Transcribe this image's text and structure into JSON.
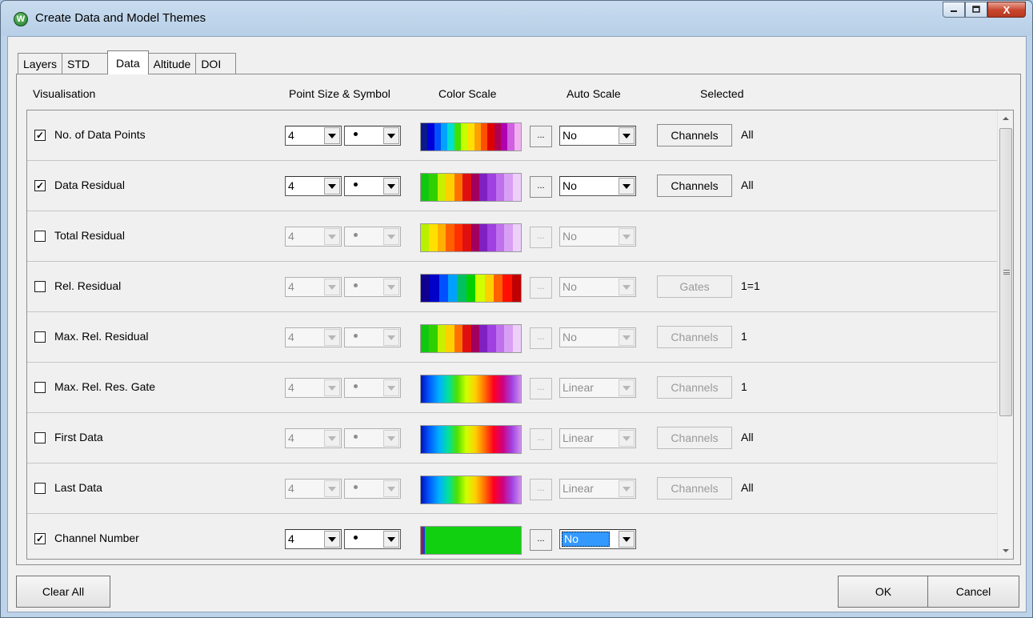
{
  "window": {
    "title": "Create Data and Model Themes",
    "icon_letter": "W"
  },
  "caption": {
    "minimize": "minimize-icon",
    "maximize": "maximize-icon",
    "close_label": "X"
  },
  "tabs": [
    {
      "label": "Layers",
      "active": false
    },
    {
      "label": "STD",
      "active": false
    },
    {
      "label": "Data",
      "active": true
    },
    {
      "label": "Altitude",
      "active": false
    },
    {
      "label": "DOI",
      "active": false
    }
  ],
  "columns": {
    "visualisation": "Visualisation",
    "point": "Point Size & Symbol",
    "color": "Color Scale",
    "auto": "Auto Scale",
    "selected": "Selected"
  },
  "rows": [
    {
      "label": "No. of Data Points",
      "checked": true,
      "check_mark": "✓",
      "size": "4",
      "symbol": "•",
      "auto": "No",
      "sel_button": "Channels",
      "sel_value": "All",
      "scale": "A"
    },
    {
      "label": "Data Residual",
      "checked": true,
      "check_mark": "✓",
      "size": "4",
      "symbol": "•",
      "auto": "No",
      "sel_button": "Channels",
      "sel_value": "All",
      "scale": "B"
    },
    {
      "label": "Total Residual",
      "checked": false,
      "check_mark": "",
      "size": "4",
      "symbol": "•",
      "auto": "No",
      "sel_button": "",
      "sel_value": "",
      "scale": "C"
    },
    {
      "label": "Rel. Residual",
      "checked": false,
      "check_mark": "",
      "size": "4",
      "symbol": "•",
      "auto": "No",
      "sel_button": "Gates",
      "sel_value": "1=1",
      "scale": "D"
    },
    {
      "label": "Max. Rel. Residual",
      "checked": false,
      "check_mark": "",
      "size": "4",
      "symbol": "•",
      "auto": "No",
      "sel_button": "Channels",
      "sel_value": "1",
      "scale": "B"
    },
    {
      "label": "Max. Rel. Res. Gate",
      "checked": false,
      "check_mark": "",
      "size": "4",
      "symbol": "•",
      "auto": "Linear",
      "sel_button": "Channels",
      "sel_value": "1",
      "scale": "G"
    },
    {
      "label": "First Data",
      "checked": false,
      "check_mark": "",
      "size": "4",
      "symbol": "•",
      "auto": "Linear",
      "sel_button": "Channels",
      "sel_value": "All",
      "scale": "G"
    },
    {
      "label": "Last Data",
      "checked": false,
      "check_mark": "",
      "size": "4",
      "symbol": "•",
      "auto": "Linear",
      "sel_button": "Channels",
      "sel_value": "All",
      "scale": "G"
    },
    {
      "label": "Channel Number",
      "checked": true,
      "check_mark": "✓",
      "size": "4",
      "symbol": "•",
      "auto": "No",
      "sel_button": "",
      "sel_value": "",
      "scale": "H"
    }
  ],
  "color_scales": {
    "A": [
      "#0a1a8c",
      "#0000d8",
      "#0050ff",
      "#00a4ff",
      "#00e0d0",
      "#40e000",
      "#c8ff00",
      "#ffe000",
      "#ffa000",
      "#ff5000",
      "#e00000",
      "#b00050",
      "#b000b0",
      "#d060e0",
      "#f0b0f0"
    ],
    "B": [
      "#10c810",
      "#30d000",
      "#c8f000",
      "#ffd000",
      "#ff7000",
      "#e01010",
      "#a00060",
      "#8020c0",
      "#a040e0",
      "#c070ec",
      "#d8a0f4",
      "#ecd0fa"
    ],
    "C": [
      "#b8f000",
      "#ffe000",
      "#ffb000",
      "#ff6000",
      "#ff3000",
      "#e01010",
      "#a00060",
      "#8020c0",
      "#a040e0",
      "#c070ec",
      "#d8a0f4",
      "#ecd0fa"
    ],
    "D": [
      "#100090",
      "#0000c8",
      "#0050ff",
      "#00a0ff",
      "#00c060",
      "#00d000",
      "#d0ff00",
      "#ffd000",
      "#ff6000",
      "#ff1000",
      "#c00000"
    ],
    "G": "linear-gradient(90deg, #0010c0, #0060ff, #00b0ff, #00e0a0, #50e000, #d0ff00, #ffd000, #ff7000, #ff0020, #d00080, #a040e0, #d090f0)",
    "H": "linear-gradient(90deg, #e00000 0 2px, #1040e0 2px 5px, #10d010 5px 100%)"
  },
  "colors": {
    "accent": "#3399ff",
    "title_bar": "#c2d7ee",
    "close": "#c7452b"
  },
  "buttons": {
    "clear_all": "Clear All",
    "ok": "OK",
    "cancel": "Cancel"
  },
  "scrollbar": {
    "up": "scroll-up-icon",
    "down": "scroll-down-icon"
  }
}
